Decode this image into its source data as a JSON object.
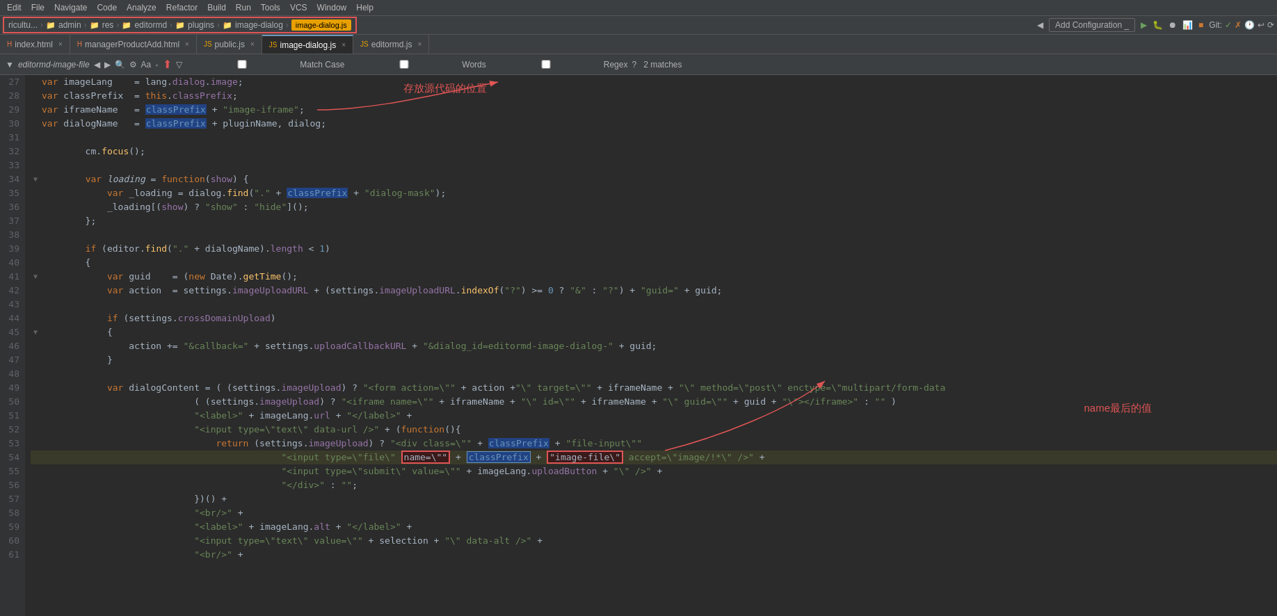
{
  "menubar": {
    "items": [
      "Edit",
      "File",
      "Navigate",
      "Code",
      "Analyze",
      "Refactor",
      "Build",
      "Run",
      "Tools",
      "VCS",
      "Window",
      "Help"
    ]
  },
  "breadcrumb": {
    "parts": [
      "ricultu...",
      "admin",
      "res",
      "editormd",
      "plugins",
      "image-dialog",
      "image-dialog.js"
    ],
    "add_config": "Add Configuration _"
  },
  "tabs": [
    {
      "label": "index.html",
      "type": "html",
      "active": false
    },
    {
      "label": "managerProductAdd.html",
      "type": "html",
      "active": false
    },
    {
      "label": "public.js",
      "type": "js",
      "active": false
    },
    {
      "label": "image-dialog.js",
      "type": "js",
      "active": true
    },
    {
      "label": "editormd.js",
      "type": "js",
      "active": false
    }
  ],
  "findbar": {
    "scope": "editormd-image-file",
    "matches": "2 matches",
    "match_case": "Match Case",
    "words": "Words",
    "regex": "Regex"
  },
  "code": {
    "lines": [
      {
        "num": 27,
        "fold": false,
        "text": "        <kw>var</kw> imageLang    = lang.<prop>dialog</prop>.<prop>image</prop>;"
      },
      {
        "num": 28,
        "fold": false,
        "text": "        <kw>var</kw> classPrefix  = <kw>this</kw>.<prop>classPrefix</prop>;"
      },
      {
        "num": 29,
        "fold": false,
        "text": "        <kw>var</kw> iframeName   = <hv>classPrefix</hv> + <str>\"image-iframe\"</str>;"
      },
      {
        "num": 30,
        "fold": false,
        "text": "        <kw>var</kw> dialogName   = <hv>classPrefix</hv> + pluginName, dialog;"
      },
      {
        "num": 31,
        "fold": false,
        "text": ""
      },
      {
        "num": 32,
        "fold": false,
        "text": "        cm.<fn>focus</fn>();"
      },
      {
        "num": 33,
        "fold": false,
        "text": ""
      },
      {
        "num": 34,
        "fold": true,
        "text": "        <kw>var</kw> <i>loading</i> = <kw>function</kw>(<prop>show</prop>) {"
      },
      {
        "num": 35,
        "fold": false,
        "text": "            <kw>var</kw> _loading = dialog.<fn>find</fn>(<str>\".\"</str> + <hv>classPrefix</hv> + <str>\"dialog-mask\"</str>);"
      },
      {
        "num": 36,
        "fold": false,
        "text": "            _loading[(<prop>show</prop>) ? <str>\"show\"</str> : <str>\"hide\"</str>]();"
      },
      {
        "num": 37,
        "fold": false,
        "text": "        };"
      },
      {
        "num": 38,
        "fold": false,
        "text": ""
      },
      {
        "num": 39,
        "fold": false,
        "text": "        <kw>if</kw> (editor.<fn>find</fn>(<str>\".\"</str> + dialogName).<prop>length</prop> < <num>1</num>)"
      },
      {
        "num": 40,
        "fold": false,
        "text": "        {"
      },
      {
        "num": 41,
        "fold": true,
        "text": "            <kw>var</kw> guid    = (<kw>new</kw> Date).<fn>getTime</fn>();"
      },
      {
        "num": 42,
        "fold": false,
        "text": "            <kw>var</kw> action  = settings.<prop>imageUploadURL</prop> + (settings.<prop>imageUploadURL</prop>.<fn>indexOf</fn>(<str>\"?\"</str>) >= <num>0</num> ? <str>\"&\"</str> : <str>\"?\"</str>) + <str>\"guid=\"</str> + guid;"
      },
      {
        "num": 43,
        "fold": false,
        "text": ""
      },
      {
        "num": 44,
        "fold": false,
        "text": "            <kw>if</kw> (settings.<prop>crossDomainUpload</prop>)"
      },
      {
        "num": 45,
        "fold": true,
        "text": "            {"
      },
      {
        "num": 46,
        "fold": false,
        "text": "                action += <str>\"&callback=\"</str> + settings.<prop>uploadCallbackURL</prop> + <str>\"&dialog_id=editormd-image-dialog-\"</str> + guid;"
      },
      {
        "num": 47,
        "fold": false,
        "text": "            }"
      },
      {
        "num": 48,
        "fold": false,
        "text": ""
      },
      {
        "num": 49,
        "fold": false,
        "text": "            <kw>var</kw> dialogContent = ( (settings.<prop>imageUpload</prop>) ? <str>\"&lt;form action=\\\"\"</str> + action +<str>\"\\\" target=\\\"\"</str> + iframeName + <str>\"\\\" method=\\\"post\\\" enctype=\\\"multipart/form-data</str>"
      },
      {
        "num": 50,
        "fold": false,
        "text": "                            ( (settings.<prop>imageUpload</prop>) ? <str>\"&lt;iframe name=\\\"\"</str> + iframeName + <str>\"\\\" id=\\\"\"</str> + iframeName + <str>\"\\\" guid=\\\"\"</str> + guid + <str>\"\\\">&lt;/iframe>\"</str> : <str>\"\"</str> )"
      },
      {
        "num": 51,
        "fold": false,
        "text": "                            <str>\"&lt;label>\"</str> + imageLang.<prop>url</prop> + <str>\"&lt;/label>\"</str> +"
      },
      {
        "num": 52,
        "fold": false,
        "text": "                            <str>\"&lt;input type=\\\"text\\\" data-url />\"</str> + (<kw>function</kw>(){"
      },
      {
        "num": 53,
        "fold": false,
        "text": "                                <kw>return</kw> (settings.<prop>imageUpload</prop>) ? <str>\"&lt;div class=\\\"\"</str> + <hv>classPrefix</hv> + <str>\"file-input\\\"\"</str>"
      },
      {
        "num": 54,
        "fold": false,
        "text": "                                            <str>\"&lt;input type=\\\"file\\\"</str> <rb>name=\\\"\"</rb> + <hv2>classPrefix</hv2> + <rb>\"image-file\\\"</rb> accept=\\\"image/!*\\\" />\"</str> +"
      },
      {
        "num": 55,
        "fold": false,
        "text": "                                            <str>\"&lt;input type=\\\"submit\\\" value=\\\"\"</str> + imageLang.<prop>uploadButton</prop> + <str>\"\\\" />\"</str> +"
      },
      {
        "num": 56,
        "fold": false,
        "text": "                                            <str>\"&lt;/div>\"</str> : <str>\"\"</str>;"
      },
      {
        "num": 57,
        "fold": false,
        "text": "                            })() +"
      },
      {
        "num": 58,
        "fold": false,
        "text": "                            <str>\"&lt;br/>\"</str> +"
      },
      {
        "num": 59,
        "fold": false,
        "text": "                            <str>\"&lt;label>\"</str> + imageLang.<prop>alt</prop> + <str>\"&lt;/label>\"</str> +"
      },
      {
        "num": 60,
        "fold": false,
        "text": "                            <str>\"&lt;input type=\\\"text\\\" value=\\\"\"</str> + selection + <str>\"\\\" data-alt />\"</str> +"
      },
      {
        "num": 61,
        "fold": false,
        "text": "                            <str>\"&lt;br/>\"</str> +"
      }
    ]
  },
  "annotations": {
    "source_code_label": "存放源代码的位置",
    "name_label": "name最后的值"
  }
}
